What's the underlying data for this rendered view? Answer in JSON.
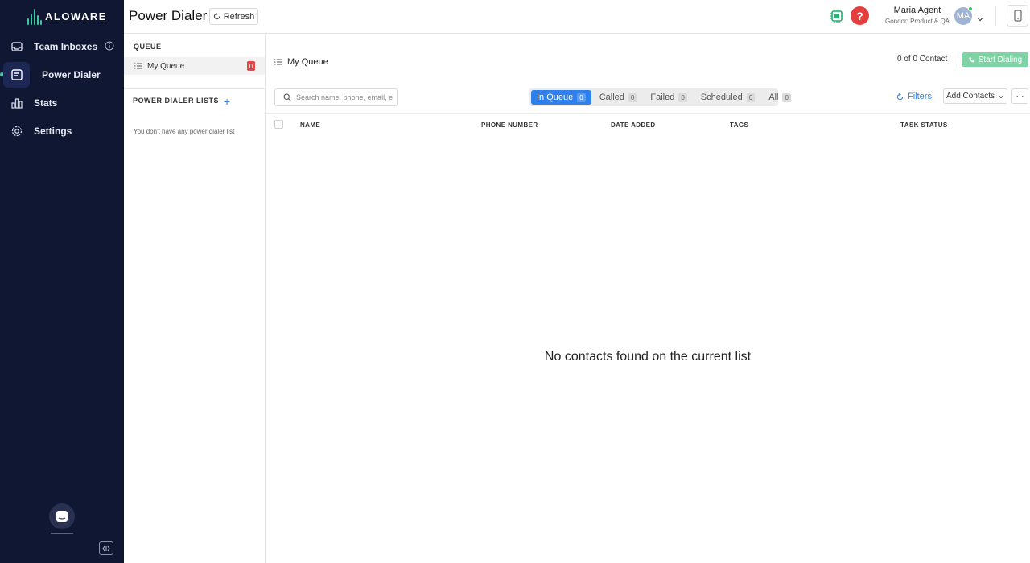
{
  "app": {
    "logo_text": "ALOWARE",
    "page_title": "Power Dialer",
    "refresh_label": "Refresh"
  },
  "sidebar": {
    "items": [
      {
        "label": "Team Inboxes",
        "icon": "inbox-icon"
      },
      {
        "label": "Power Dialer",
        "icon": "power-dialer-icon",
        "active": true
      },
      {
        "label": "Stats",
        "icon": "stats-icon"
      },
      {
        "label": "Settings",
        "icon": "gear-icon"
      }
    ]
  },
  "user": {
    "name": "Maria Agent",
    "team": "Gondor: Product & QA",
    "initials": "MA"
  },
  "queue_panel": {
    "queue_header": "QUEUE",
    "queue_item_label": "My Queue",
    "queue_item_count": "0",
    "lists_header": "POWER DIALER LISTS",
    "add_list_symbol": "+",
    "empty_lists_text": "You don't have any power dialer list"
  },
  "main": {
    "title": "My Queue",
    "contact_count": "0 of 0 Contact",
    "start_dialing_label": "Start Dialing",
    "search_placeholder": "Search name, phone, email, etc",
    "tabs": [
      {
        "label": "In Queue",
        "count": "0",
        "active": true
      },
      {
        "label": "Called",
        "count": "0"
      },
      {
        "label": "Failed",
        "count": "0"
      },
      {
        "label": "Scheduled",
        "count": "0"
      },
      {
        "label": "All",
        "count": "0"
      }
    ],
    "filters_label": "Filters",
    "add_contacts_label": "Add Contacts",
    "more_label": "···",
    "columns": [
      "NAME",
      "PHONE NUMBER",
      "DATE ADDED",
      "TAGS",
      "TASK STATUS"
    ],
    "empty_message": "No contacts found on the current list"
  },
  "colors": {
    "sidebar_bg": "#0f1733",
    "accent_green": "#3cc7a3",
    "active_tab": "#2f80ed",
    "start_button": "#7fd4a6",
    "help_red": "#e53e3e"
  }
}
